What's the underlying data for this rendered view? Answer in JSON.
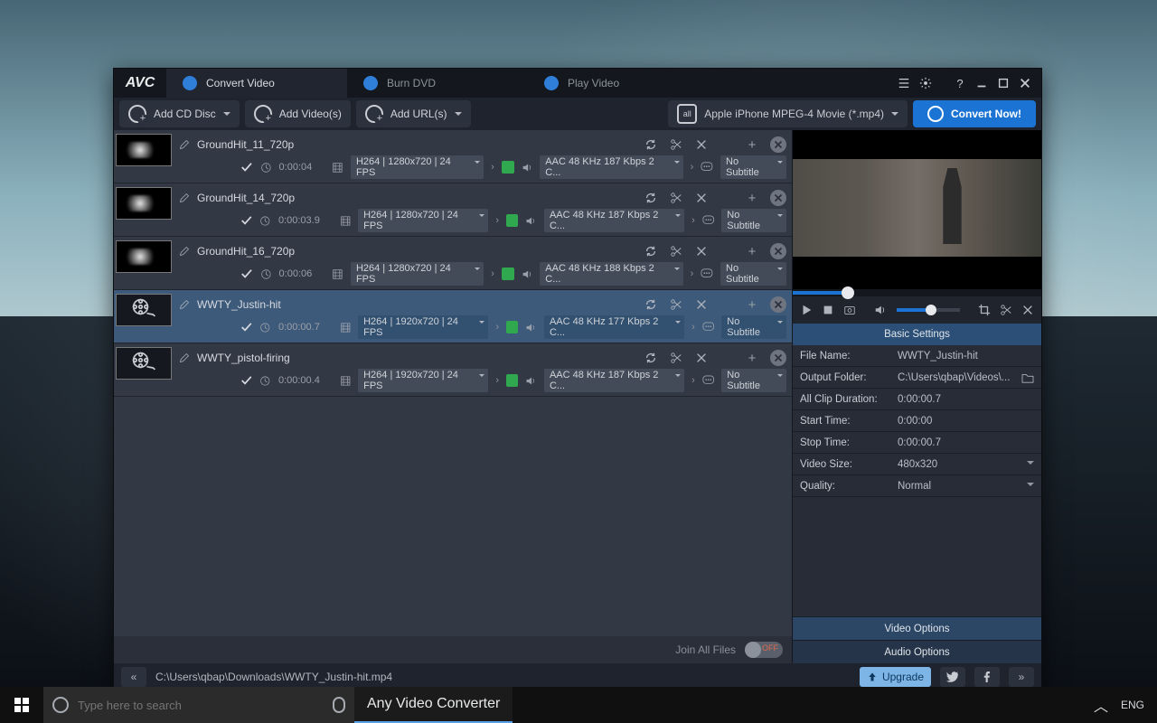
{
  "logo": "AVC",
  "tabs": [
    {
      "label": "Convert Video"
    },
    {
      "label": "Burn DVD"
    },
    {
      "label": "Play Video"
    }
  ],
  "toolbar": {
    "add_cd": "Add CD Disc",
    "add_videos": "Add Video(s)",
    "add_urls": "Add URL(s)",
    "profile": "Apple iPhone MPEG-4 Movie (*.mp4)",
    "profile_icon": "all",
    "convert": "Convert Now!"
  },
  "items": [
    {
      "name": "GroundHit_11_720p",
      "selected": false,
      "thumb": "smoke",
      "duration": "0:00:04",
      "codec": "H264",
      "resolution": "1280x720",
      "fps": "24 FPS",
      "audio": "AAC 48 KHz 187 Kbps 2 C...",
      "subtitle": "No Subtitle"
    },
    {
      "name": "GroundHit_14_720p",
      "selected": false,
      "thumb": "smoke",
      "duration": "0:00:03.9",
      "codec": "H264",
      "resolution": "1280x720",
      "fps": "24 FPS",
      "audio": "AAC 48 KHz 187 Kbps 2 C...",
      "subtitle": "No Subtitle"
    },
    {
      "name": "GroundHit_16_720p",
      "selected": false,
      "thumb": "smoke",
      "duration": "0:00:06",
      "codec": "H264",
      "resolution": "1280x720",
      "fps": "24 FPS",
      "audio": "AAC 48 KHz 188 Kbps 2 C...",
      "subtitle": "No Subtitle"
    },
    {
      "name": "WWTY_Justin-hit",
      "selected": true,
      "thumb": "film",
      "duration": "0:00:00.7",
      "codec": "H264",
      "resolution": "1920x720",
      "fps": "24 FPS",
      "audio": "AAC 48 KHz 177 Kbps 2 C...",
      "subtitle": "No Subtitle"
    },
    {
      "name": "WWTY_pistol-firing",
      "selected": false,
      "thumb": "film",
      "duration": "0:00:00.4",
      "codec": "H264",
      "resolution": "1920x720",
      "fps": "24 FPS",
      "audio": "AAC 48 KHz 187 Kbps 2 C...",
      "subtitle": "No Subtitle"
    }
  ],
  "join": {
    "label": "Join All Files",
    "state": "OFF"
  },
  "settings": {
    "header": "Basic Settings",
    "rows": {
      "file_name_k": "File Name:",
      "file_name_v": "WWTY_Justin-hit",
      "out_k": "Output Folder:",
      "out_v": "C:\\Users\\qbap\\Videos\\...",
      "dur_k": "All Clip Duration:",
      "dur_v": "0:00:00.7",
      "start_k": "Start Time:",
      "start_v": "0:00:00",
      "stop_k": "Stop Time:",
      "stop_v": "0:00:00.7",
      "vsize_k": "Video Size:",
      "vsize_v": "480x320",
      "qual_k": "Quality:",
      "qual_v": "Normal"
    },
    "video_options": "Video Options",
    "audio_options": "Audio Options"
  },
  "bottom": {
    "path": "C:\\Users\\qbap\\Downloads\\WWTY_Justin-hit.mp4",
    "upgrade": "Upgrade"
  },
  "taskbar": {
    "search_placeholder": "Type here to search",
    "app": "Any Video Converter",
    "lang": "ENG"
  }
}
